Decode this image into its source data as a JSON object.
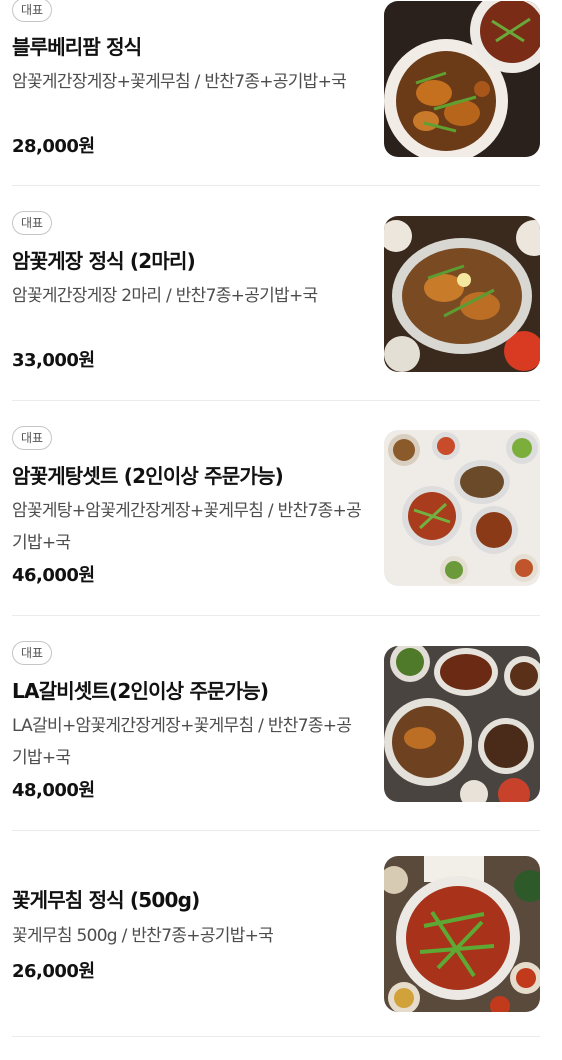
{
  "menu": {
    "items": [
      {
        "badge": "대표",
        "name": "블루베리팜 정식",
        "description": "암꽃게간장게장+꽃게무침 / 반찬7종+공기밥+국",
        "price": "28,000원",
        "image": "food-photo-crab-platter"
      },
      {
        "badge": "대표",
        "name": "암꽃게장 정식 (2마리)",
        "description": "암꽃게간장게장 2마리 / 반찬7종+공기밥+국",
        "price": "33,000원",
        "image": "food-photo-soy-crab-bowl"
      },
      {
        "badge": "대표",
        "name": "암꽃게탕셋트 (2인이상 주문가능)",
        "description": "암꽃게탕+암꽃게간장게장+꽃게무침 / 반찬7종+공기밥+국",
        "price": "46,000원",
        "image": "food-photo-crab-stew-set"
      },
      {
        "badge": "대표",
        "name": "LA갈비셋트(2인이상 주문가능)",
        "description": "LA갈비+암꽃게간장게장+꽃게무침 / 반찬7종+공기밥+국",
        "price": "48,000원",
        "image": "food-photo-galbi-set"
      },
      {
        "name": "꽃게무침 정식 (500g)",
        "description": "꽃게무침 500g / 반찬7종+공기밥+국",
        "price": "26,000원",
        "image": "food-photo-spicy-crab"
      }
    ]
  }
}
